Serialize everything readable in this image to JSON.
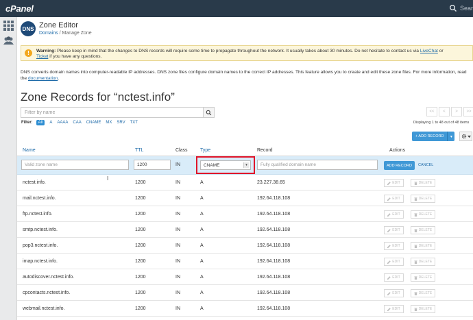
{
  "topbar": {
    "logo": "cPanel",
    "search_label": "Search"
  },
  "sidebar": {
    "items": [
      {
        "icon": "grid-icon"
      },
      {
        "icon": "users-icon"
      }
    ]
  },
  "page": {
    "icon_text": "DNS",
    "title": "Zone Editor",
    "breadcrumb": {
      "domains": "Domains",
      "sep": "/",
      "current": "Manage Zone"
    }
  },
  "warning": {
    "label": "Warning:",
    "text": "Please keep in mind that the changes to DNS records will require some time to propagate throughout the network. It usually takes about 30 minutes. Do not hesitate to contact us via",
    "livechat": "LiveChat",
    "or": "or",
    "ticket": "Ticket",
    "tail": "if you have any questions."
  },
  "description": {
    "text": "DNS converts domain names into computer-readable IP addresses. DNS zone files configure domain names to the correct IP addresses. This feature allows you to create and edit these zone files. For more information, read the",
    "link": "documentation",
    "end": "."
  },
  "zone": {
    "heading": "Zone Records for “nctest.info”"
  },
  "filter": {
    "placeholder": "Filter by name",
    "label": "Filter:",
    "options": [
      "All",
      "A",
      "AAAA",
      "CAA",
      "CNAME",
      "MX",
      "SRV",
      "TXT"
    ],
    "active": "All"
  },
  "pager": {
    "buttons": [
      "<<",
      "<",
      ">",
      ">>"
    ],
    "displaying": "Displaying 1 to 48 out of 48 items"
  },
  "toolbar": {
    "add_record": "+ ADD RECORD",
    "caret": "▾"
  },
  "table": {
    "headers": {
      "name": "Name",
      "ttl": "TTL",
      "class": "Class",
      "type": "Type",
      "record": "Record",
      "actions": "Actions"
    },
    "new_row": {
      "name_placeholder": "Valid zone name",
      "ttl": "1200",
      "class": "IN",
      "type": "CNAME",
      "record_placeholder": "Fully qualified domain name",
      "add_label": "ADD RECORD",
      "cancel_label": "CANCEL"
    },
    "edit_label": "EDIT",
    "delete_label": "DELETE",
    "rows": [
      {
        "name": "nctest.info.",
        "ttl": "1200",
        "class": "IN",
        "type": "A",
        "record": "23.227.38.65"
      },
      {
        "name": "mail.nctest.info.",
        "ttl": "1200",
        "class": "IN",
        "type": "A",
        "record": "192.64.118.108"
      },
      {
        "name": "ftp.nctest.info.",
        "ttl": "1200",
        "class": "IN",
        "type": "A",
        "record": "192.64.118.108"
      },
      {
        "name": "smtp.nctest.info.",
        "ttl": "1200",
        "class": "IN",
        "type": "A",
        "record": "192.64.118.108"
      },
      {
        "name": "pop3.nctest.info.",
        "ttl": "1200",
        "class": "IN",
        "type": "A",
        "record": "192.64.118.108"
      },
      {
        "name": "imap.nctest.info.",
        "ttl": "1200",
        "class": "IN",
        "type": "A",
        "record": "192.64.118.108"
      },
      {
        "name": "autodiscover.nctest.info.",
        "ttl": "1200",
        "class": "IN",
        "type": "A",
        "record": "192.64.118.108"
      },
      {
        "name": "cpcontacts.nctest.info.",
        "ttl": "1200",
        "class": "IN",
        "type": "A",
        "record": "192.64.118.108"
      },
      {
        "name": "webmail.nctest.info.",
        "ttl": "1200",
        "class": "IN",
        "type": "A",
        "record": "192.64.118.108"
      }
    ]
  },
  "colors": {
    "topbar": "#293a4a",
    "accent": "#3f98d6",
    "highlight": "#e0142a",
    "warning_bg": "#fcf6db"
  }
}
